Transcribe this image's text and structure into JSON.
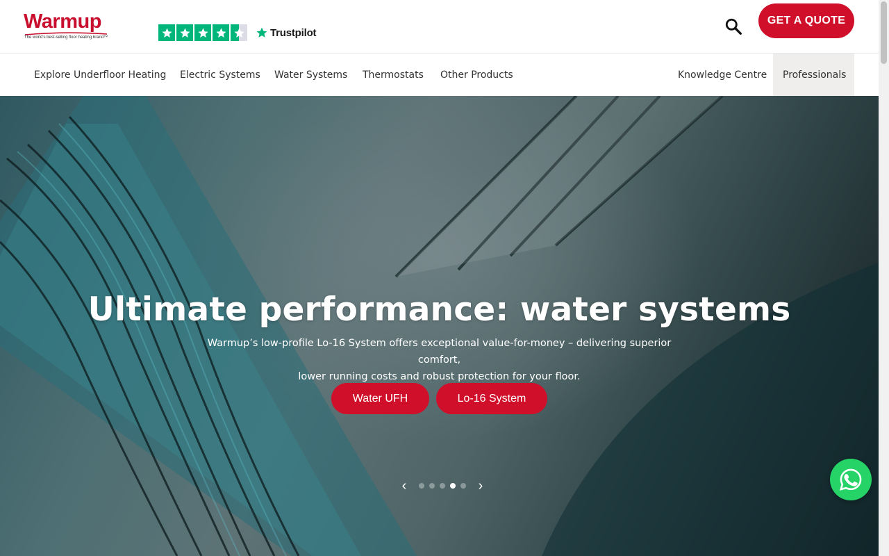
{
  "header": {
    "logo": {
      "name": "Warmup",
      "tagline": "The world's best-selling floor heating brand™",
      "color": "#c8102e"
    },
    "trustpilot": {
      "brand": "Trustpilot",
      "rating_stars": 4.5,
      "star_color": "#00b67a"
    },
    "search_icon": "search-icon",
    "quote_button": "GET A QUOTE"
  },
  "nav": {
    "items": [
      {
        "label": "Explore Underfloor Heating"
      },
      {
        "label": "Electric Systems"
      },
      {
        "label": "Water Systems"
      },
      {
        "label": "Thermostats"
      },
      {
        "label": "Other Products"
      },
      {
        "label": "Knowledge Centre"
      },
      {
        "label": "Professionals"
      }
    ]
  },
  "hero": {
    "title": "Ultimate performance: water systems",
    "subtitle_line1": "Warmup’s low-profile Lo-16 System offers exceptional value-for-money – delivering superior comfort,",
    "subtitle_line2": "lower running costs and robust protection for your floor.",
    "buttons": [
      {
        "label": "Water UFH"
      },
      {
        "label": "Lo-16 System"
      }
    ],
    "slider": {
      "prev": "‹",
      "next": "›",
      "slide_count": 5,
      "active_slide": 4
    }
  },
  "colors": {
    "brand_red": "#d0102b",
    "whatsapp": "#25d366"
  },
  "whatsapp_icon": "whatsapp-icon"
}
